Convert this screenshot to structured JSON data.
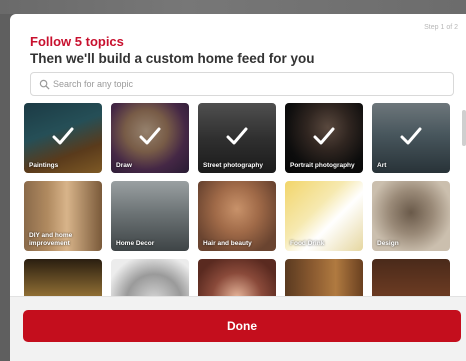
{
  "modal": {
    "step": "Step 1 of 2",
    "title": "Follow 5 topics",
    "subtitle": "Then we'll build a custom home feed for you"
  },
  "search": {
    "placeholder": "Search for any topic"
  },
  "topics": [
    {
      "label": "Paintings",
      "selected": true
    },
    {
      "label": "Draw",
      "selected": true
    },
    {
      "label": "Street photography",
      "selected": true
    },
    {
      "label": "Portrait photography",
      "selected": true
    },
    {
      "label": "Art",
      "selected": true
    },
    {
      "label": "DIY and home improvement",
      "selected": false
    },
    {
      "label": "Home Decor",
      "selected": false
    },
    {
      "label": "Hair and beauty",
      "selected": false
    },
    {
      "label": "Food Drink",
      "selected": false
    },
    {
      "label": "Design",
      "selected": false
    },
    {
      "label": "",
      "selected": false
    },
    {
      "label": "",
      "selected": false
    },
    {
      "label": "",
      "selected": false
    },
    {
      "label": "",
      "selected": false
    },
    {
      "label": "",
      "selected": false
    }
  ],
  "footer": {
    "done_label": "Done"
  },
  "colors": {
    "accent": "#c8102e",
    "button": "#c40e1d"
  }
}
